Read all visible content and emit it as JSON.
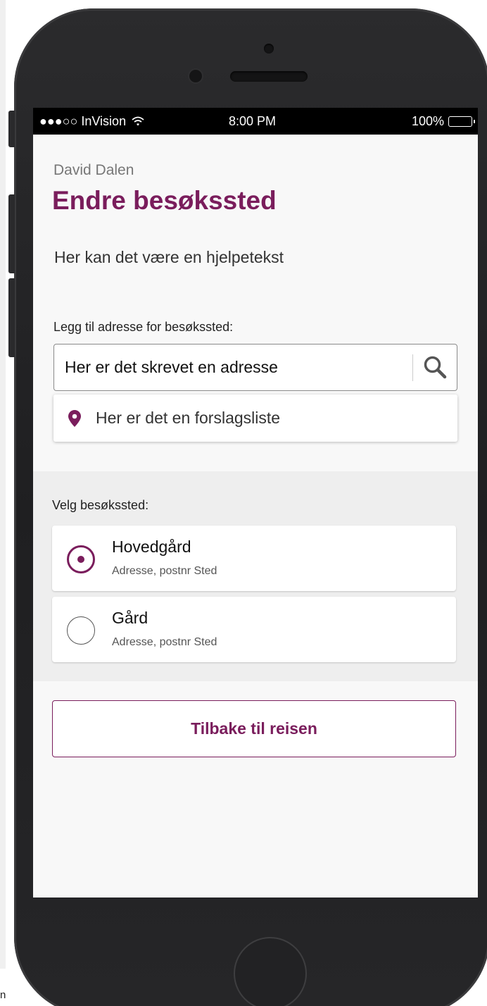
{
  "status_bar": {
    "carrier": "●●●○○ InVision",
    "wifi_icon": "wifi-icon",
    "time": "8:00 PM",
    "battery": "100%",
    "battery_level": 1.0
  },
  "header": {
    "user_name": "David Dalen",
    "title": "Endre besøkssted",
    "help_text": "Her kan det være en hjelpetekst"
  },
  "address": {
    "label": "Legg til adresse for besøkssted:",
    "value": "Her er det skrevet en adresse",
    "search_icon": "search-icon",
    "suggestion_icon": "map-pin-icon",
    "suggestion": "Her er det en forslagsliste"
  },
  "choose": {
    "label": "Velg besøkssted:",
    "options": [
      {
        "title": "Hovedgård",
        "subtitle": "Adresse, postnr Sted",
        "selected": true
      },
      {
        "title": "Gård",
        "subtitle": "Adresse, postnr Sted",
        "selected": false
      }
    ]
  },
  "back_button": {
    "label": "Tilbake til reisen"
  },
  "colors": {
    "accent": "#7a1d5c",
    "screen_bg": "#f8f8f8",
    "section_bg": "#eeeeee",
    "device_body": "#242426"
  },
  "page_corner_text": "n"
}
